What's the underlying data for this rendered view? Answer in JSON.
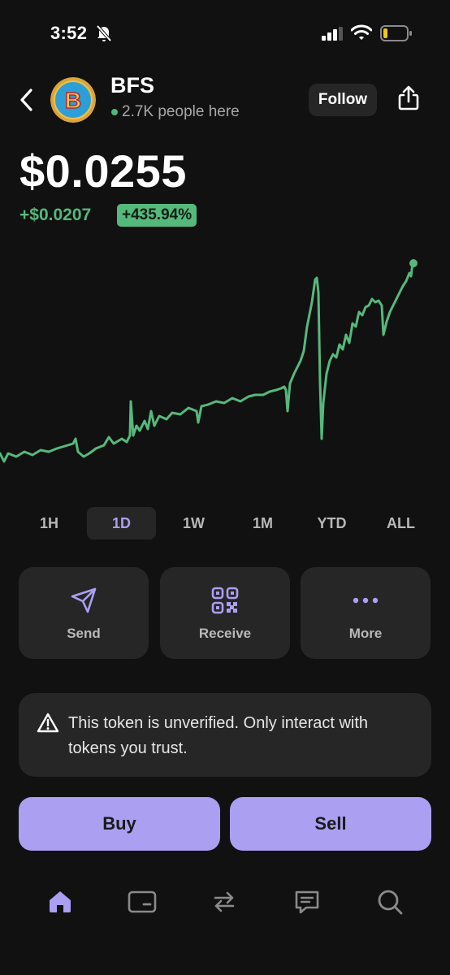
{
  "status_bar": {
    "time": "3:52"
  },
  "header": {
    "token_symbol": "BFS",
    "avatar_letter": "B",
    "people_count": "2.7K people here",
    "follow_label": "Follow"
  },
  "price": {
    "value": "$0.0255",
    "change_abs": "+$0.0207",
    "change_pct": "+435.94%"
  },
  "range_tabs": [
    "1H",
    "1D",
    "1W",
    "1M",
    "YTD",
    "ALL"
  ],
  "selected_range": "1D",
  "actions": [
    {
      "label": "Send",
      "icon": "send-icon"
    },
    {
      "label": "Receive",
      "icon": "qr-code-icon"
    },
    {
      "label": "More",
      "icon": "more-icon"
    }
  ],
  "warning": {
    "icon": "warning-icon",
    "text": "This token is unverified. Only interact with tokens you trust."
  },
  "trade": {
    "buy_label": "Buy",
    "sell_label": "Sell"
  },
  "nav": [
    "home-icon",
    "wallet-card-icon",
    "swap-icon",
    "chat-icon",
    "search-icon"
  ],
  "colors": {
    "background": "#111111",
    "card": "#262626",
    "accent": "#ab9ff2",
    "positive": "#55b97c"
  }
}
